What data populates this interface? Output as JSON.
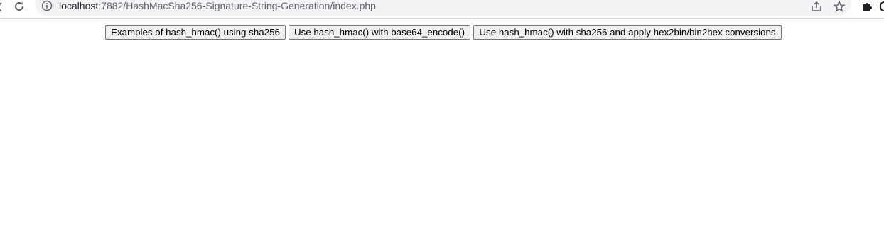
{
  "browser": {
    "url_host": "localhost",
    "url_path": ":7882/HashMacSha256-Signature-String-Generation/index.php"
  },
  "page": {
    "buttons": [
      {
        "label": "Examples of hash_hmac() using sha256"
      },
      {
        "label": "Use hash_hmac() with base64_encode()"
      },
      {
        "label": "Use hash_hmac() with sha256 and apply hex2bin/bin2hex conversions"
      }
    ]
  },
  "icons": {
    "back": "back-arrow-icon",
    "reload": "reload-icon",
    "info": "info-icon",
    "share": "share-icon",
    "star": "star-icon",
    "extensions": "puzzle-icon",
    "profile": "profile-icon"
  },
  "colors": {
    "omnibox_bg": "#f1f3f4",
    "icon_gray": "#5f6368",
    "button_bg": "#efefef",
    "button_border": "#767676"
  }
}
